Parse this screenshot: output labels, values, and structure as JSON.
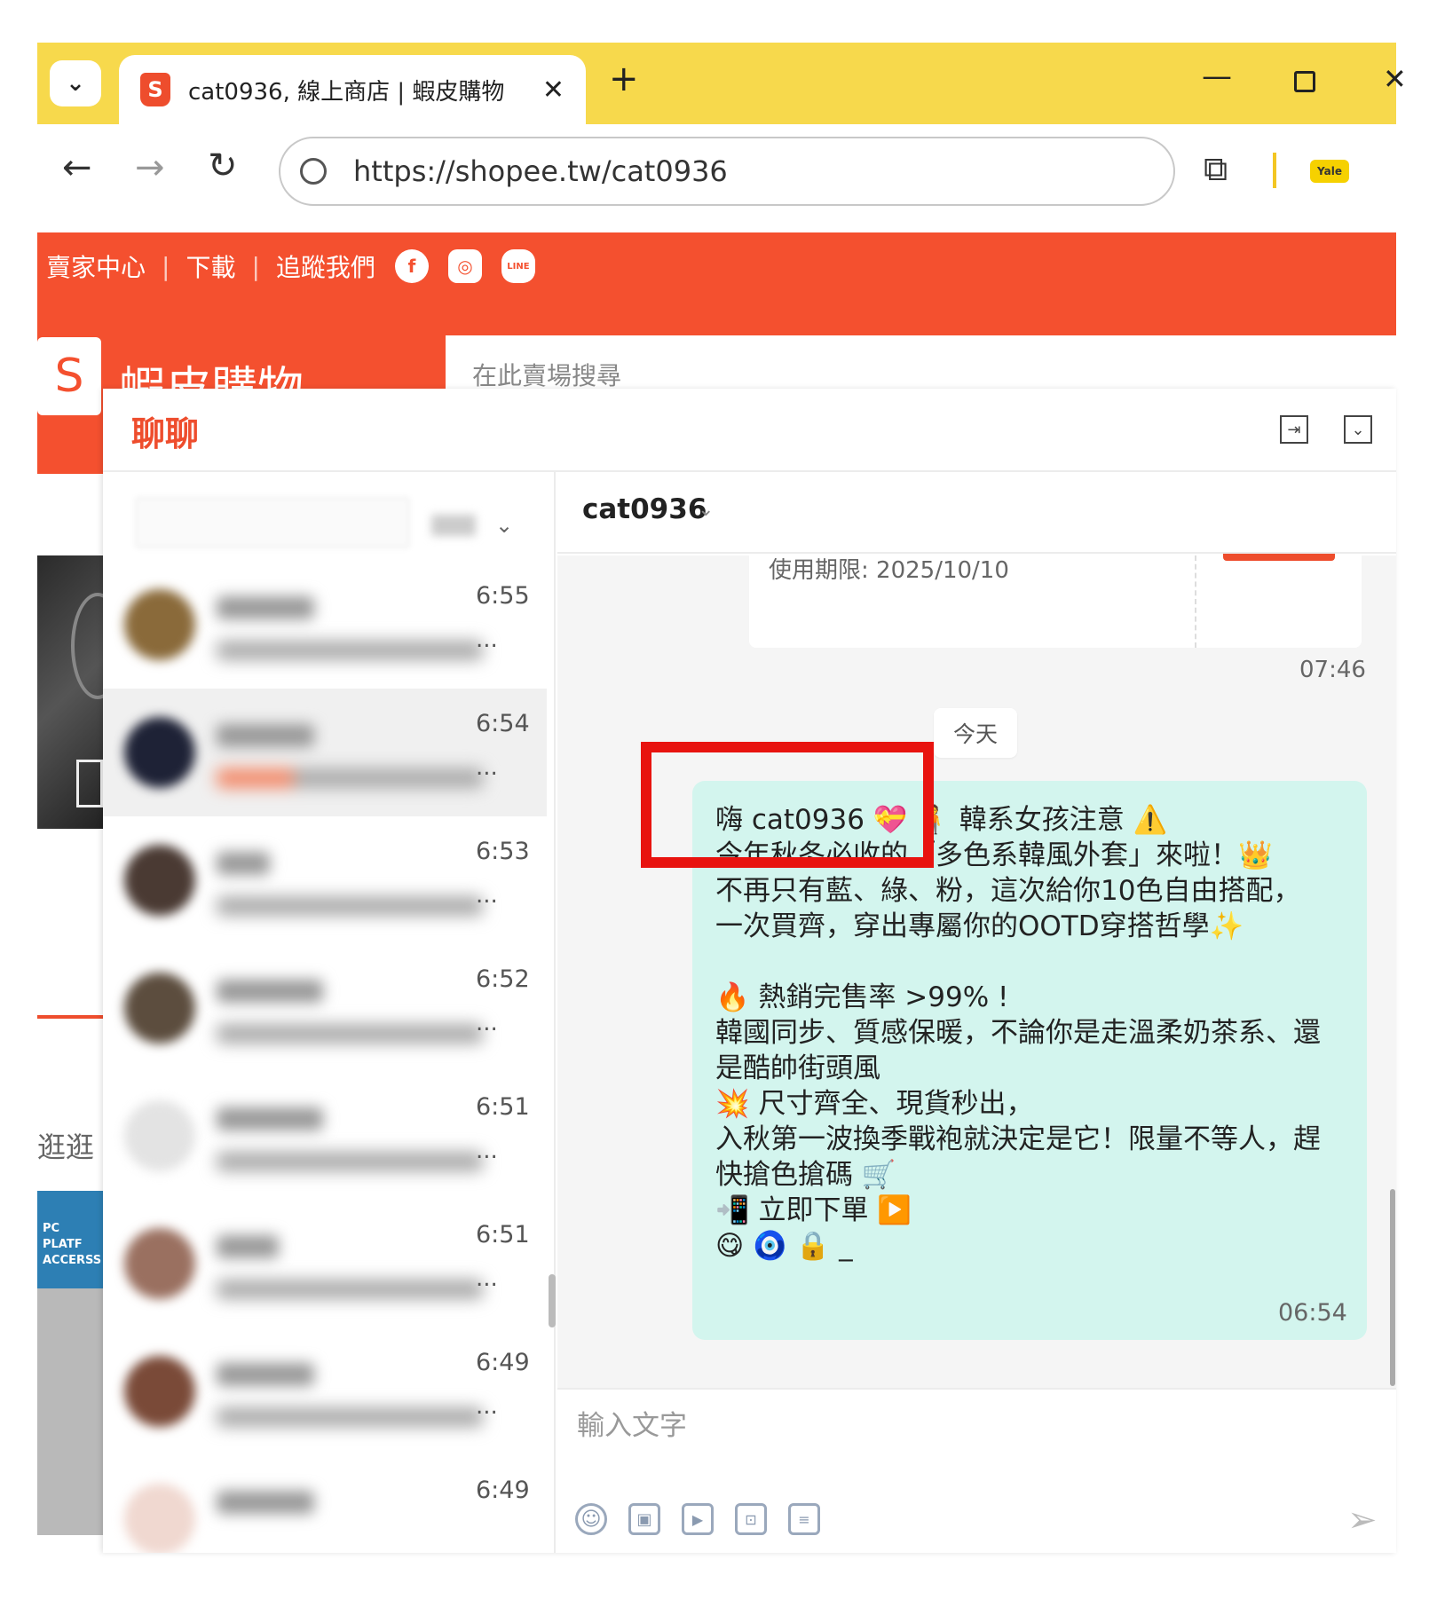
{
  "browser": {
    "tab_title": "cat0936, 線上商店 | 蝦皮購物",
    "tab_favicon": "S",
    "tab_close": "✕",
    "new_tab": "+",
    "url": "https://shopee.tw/cat0936",
    "dropdown_icon": "⌄",
    "window_min": "—",
    "window_close": "✕",
    "nav_back": "←",
    "nav_forward": "→",
    "nav_reload": "↻",
    "extension_icon": "puzzle-icon",
    "yale_label": "Yale"
  },
  "shopee": {
    "links": [
      "賣家中心",
      "下載",
      "追蹤我們"
    ],
    "link_separator": "|",
    "social": {
      "facebook": "f",
      "instagram": "◎",
      "line": "LINE"
    },
    "logo_letter": "S",
    "brand": "蝦皮購物",
    "search_placeholder": "在此賣場搜尋",
    "browse_label": "逛逛",
    "card_text": "PC PLATF ACCERSS"
  },
  "chat": {
    "title": "聊聊",
    "popout_icon": "⇥",
    "collapse_icon": "⌄",
    "filter_chevron": "⌄",
    "conversations": [
      {
        "time": "6:55",
        "ellipsis": "..."
      },
      {
        "time": "6:54",
        "ellipsis": "..."
      },
      {
        "time": "6:53",
        "ellipsis": "..."
      },
      {
        "time": "6:52",
        "ellipsis": "..."
      },
      {
        "time": "6:51",
        "ellipsis": "..."
      },
      {
        "time": "6:51",
        "ellipsis": "..."
      },
      {
        "time": "6:49",
        "ellipsis": "..."
      },
      {
        "time": "6:49",
        "ellipsis": ""
      }
    ],
    "partner_name": "cat0936",
    "partner_chevron": "⌄",
    "previous_card_text": "使用期限: 2025/10/10",
    "previous_time": "07:46",
    "date_divider": "今天",
    "message_text": "嗨 cat0936 💝 🧍 韓系女孩注意 ⚠️\n今年秋冬必收的「多色系韓風外套」來啦！👑\n不再只有藍、綠、粉，這次給你10色自由搭配，\n一次買齊，穿出專屬你的OOTD穿搭哲學✨\n\n🔥 熱銷完售率 >99% !\n韓國同步、質感保暖，不論你是走溫柔奶茶系、還是酷帥街頭風\n💥 尺寸齊全、現貨秒出，\n入秋第一波換季戰袍就決定是它！限量不等人，趕快搶色搶碼 🛒\n📲 立即下單 ▶️\n😋 🧿 🔒 _",
    "message_time": "06:54",
    "composer_placeholder": "輸入文字",
    "tools": {
      "emoji": "☺",
      "image": "▣",
      "video": "▶",
      "product": "⊡",
      "order": "≡"
    },
    "send_icon": "➢"
  },
  "colors": {
    "browser_accent": "#f7d94c",
    "shopee_orange": "#f4502f",
    "chat_title": "#ee4d2d",
    "bubble": "#d3f5ee",
    "highlight": "#e8130f"
  }
}
